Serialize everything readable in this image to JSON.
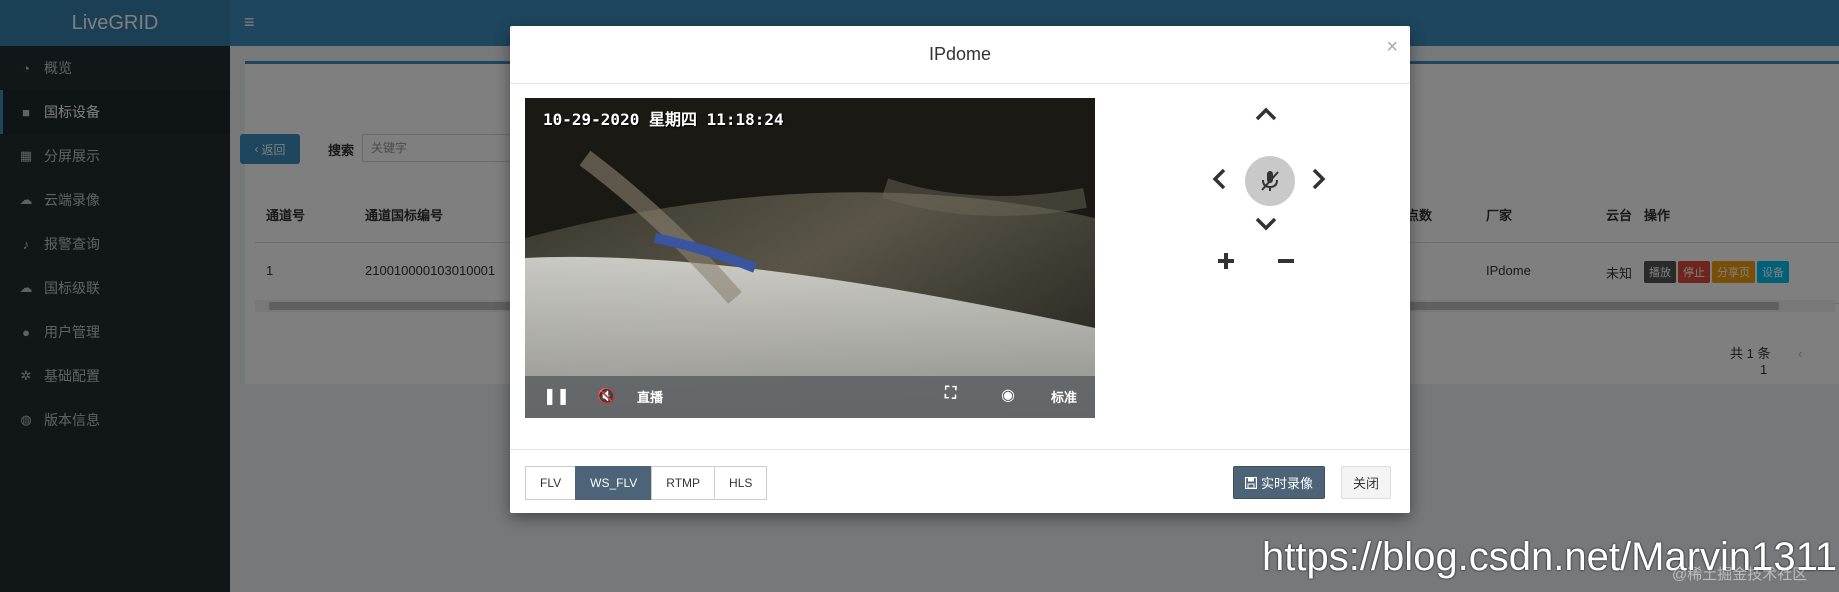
{
  "app": {
    "logo": "LiveGRID",
    "menu_icon": "hamburger-icon"
  },
  "sidebar": {
    "items": [
      {
        "label": "概览",
        "icon": "dashboard-icon"
      },
      {
        "label": "国标设备",
        "icon": "video-camera-icon",
        "active": true
      },
      {
        "label": "分屏展示",
        "icon": "grid-icon"
      },
      {
        "label": "云端录像",
        "icon": "cloud-icon"
      },
      {
        "label": "报警查询",
        "icon": "bell-icon"
      },
      {
        "label": "国标级联",
        "icon": "cloud-upload-icon"
      },
      {
        "label": "用户管理",
        "icon": "users-icon"
      },
      {
        "label": "基础配置",
        "icon": "gears-icon"
      },
      {
        "label": "版本信息",
        "icon": "globe-icon"
      }
    ]
  },
  "toolbar": {
    "back_label": "返回",
    "search_label": "搜索",
    "search_placeholder": "关键字"
  },
  "table": {
    "headers": [
      "通道号",
      "通道国标编号",
      "点数",
      "厂家",
      "云台",
      "操作"
    ],
    "row": {
      "channel": "1",
      "code": "210010000103010001",
      "vendor": "IPdome",
      "ptz": "未知"
    },
    "ops": [
      "播放",
      "停止",
      "分享页",
      "设备"
    ],
    "pager_total": "共 1 条",
    "pager_page": "1"
  },
  "modal": {
    "title": "IPdome",
    "close_glyph": "×",
    "video": {
      "osd": "10-29-2020 星期四 11:18:24",
      "live_label": "直播",
      "quality_label": "标准"
    },
    "protocols": [
      "FLV",
      "WS_FLV",
      "RTMP",
      "HLS"
    ],
    "active_protocol": "WS_FLV",
    "record_label": "实时录像",
    "close_label": "关闭"
  },
  "watermark": {
    "url": "https://blog.csdn.net/Marvin1311",
    "site": "@稀土掘金技术社区"
  }
}
